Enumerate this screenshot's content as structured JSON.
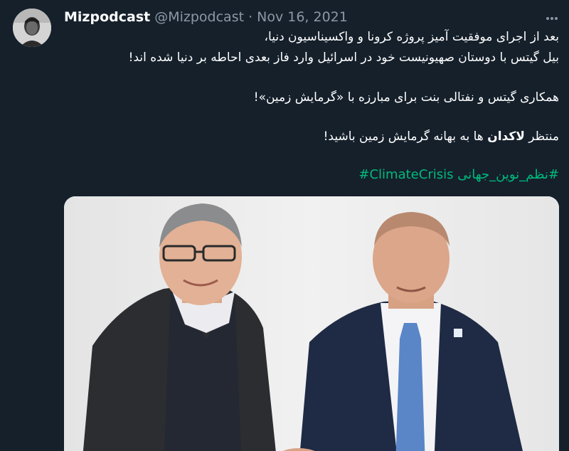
{
  "author": {
    "display_name": "Mizpodcast",
    "handle": "@Mizpodcast",
    "separator": "·",
    "date": "Nov 16, 2021",
    "avatar_icon": "profile-avatar"
  },
  "tweet": {
    "line1": "بعد از اجرای موفقیت آمیز پروژه کرونا و واکسیناسیون دنیا،",
    "line2": "بیل گیتس با دوستان صهیونیست خود در اسرائیل وارد فاز بعدی احاطه بر دنیا شده اند!",
    "line3": "همکاری گیتس و نفتالی بنت برای مبارزه با «گرمایش زمین»!",
    "line4_pre": "منتظر ",
    "line4_bold": "لاکدان",
    "line4_post": " ها به بهانه گرمایش زمین باشید!",
    "hashtag1": "#ClimateCrisis",
    "hashtag2": "#نظم_نوین_جهانی"
  },
  "icons": {
    "more": "more-options-icon"
  },
  "colors": {
    "background": "#15202b",
    "text": "#ffffff",
    "secondary": "#8b98a5",
    "hashtag": "#00ba7c"
  }
}
